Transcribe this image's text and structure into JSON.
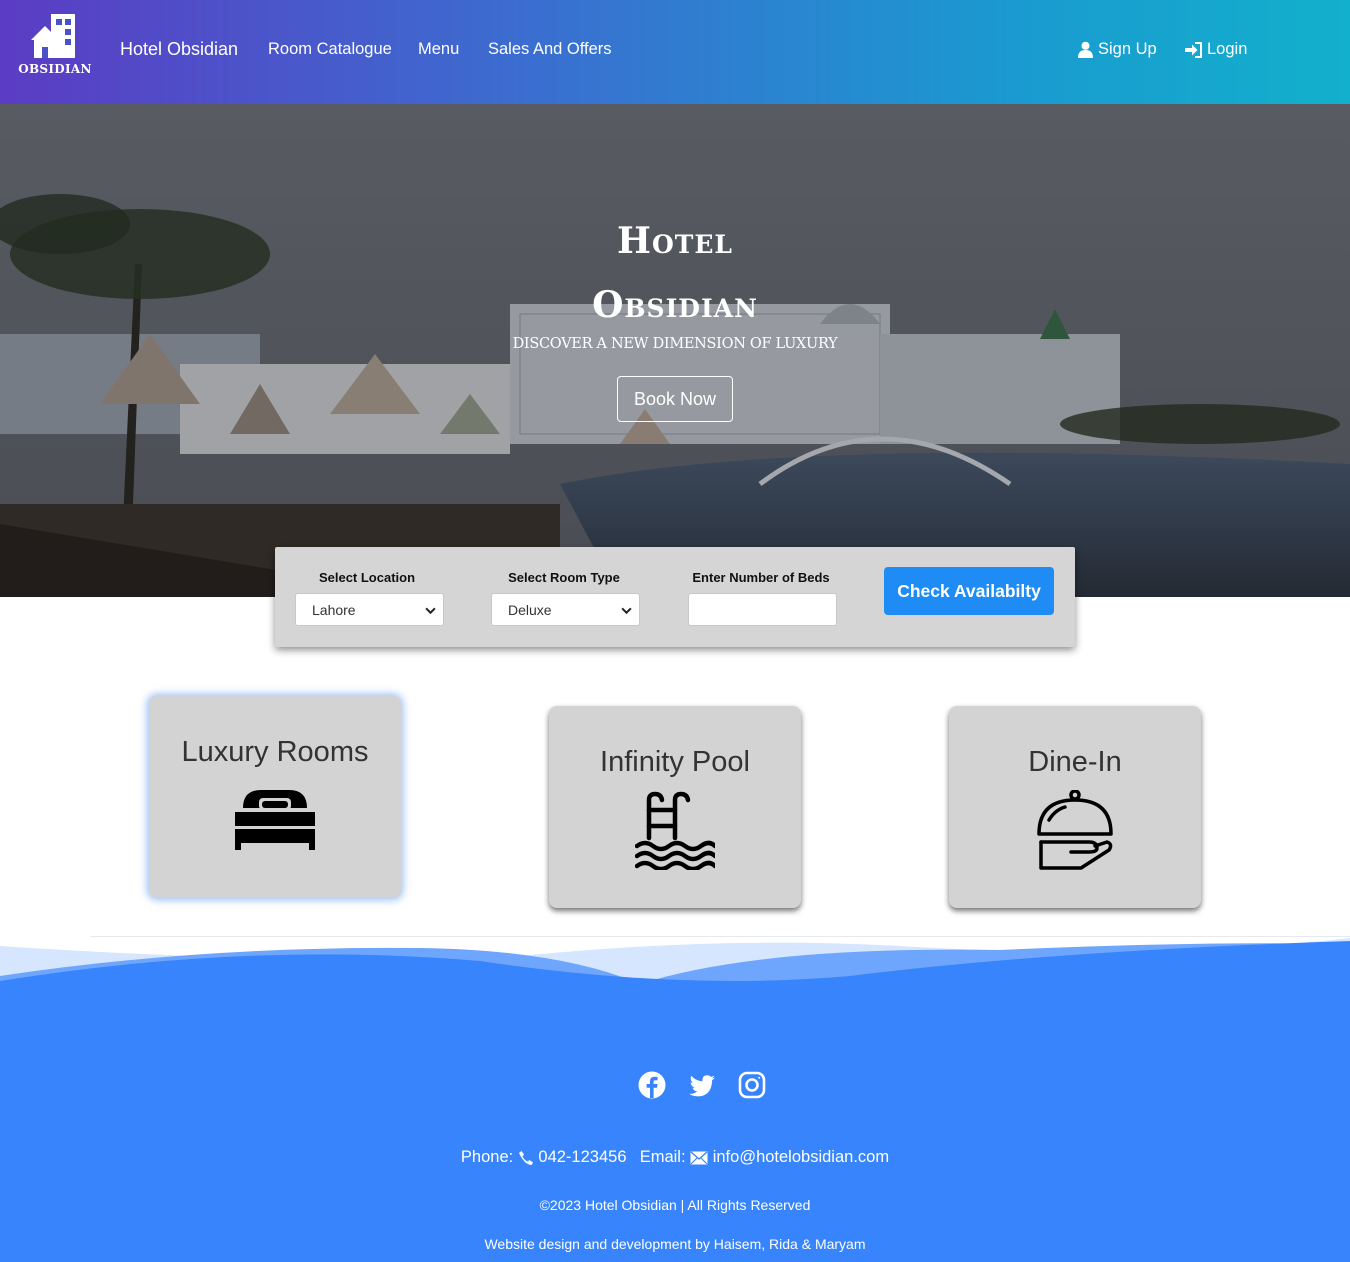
{
  "navbar": {
    "logo_text": "OBSIDIAN",
    "brand": "Hotel Obsidian",
    "links": [
      "Room Catalogue",
      "Menu",
      "Sales And Offers"
    ],
    "signup": "Sign Up",
    "login": "Login"
  },
  "hero": {
    "title_line1": "Hotel",
    "title_line2": "Obsidian",
    "subtitle": "DISCOVER A NEW DIMENSION OF LUXURY",
    "book_button": "Book Now"
  },
  "search": {
    "location_label": "Select Location",
    "location_value": "Lahore",
    "room_type_label": "Select Room Type",
    "room_type_value": "Deluxe",
    "beds_label": "Enter Number of Beds",
    "beds_value": "",
    "check_button": "Check Availabilty"
  },
  "features": [
    {
      "title": "Luxury Rooms",
      "icon": "bed-icon"
    },
    {
      "title": "Infinity Pool",
      "icon": "pool-icon"
    },
    {
      "title": "Dine-In",
      "icon": "cloche-icon"
    }
  ],
  "footer": {
    "social": [
      "facebook-icon",
      "twitter-icon",
      "instagram-icon"
    ],
    "phone_label": "Phone:",
    "phone": "042-123456",
    "email_label": "Email:",
    "email": "info@hotelobsidian.com",
    "copyright": "©2023 Hotel Obsidian | All Rights Reserved",
    "credit": "Website design and development by Haisem, Rida & Maryam"
  },
  "colors": {
    "nav_gradient_start": "#5b3cc4",
    "nav_gradient_end": "#12b0cc",
    "accent_button": "#1f8cf5",
    "footer_blue": "#3784fc"
  }
}
